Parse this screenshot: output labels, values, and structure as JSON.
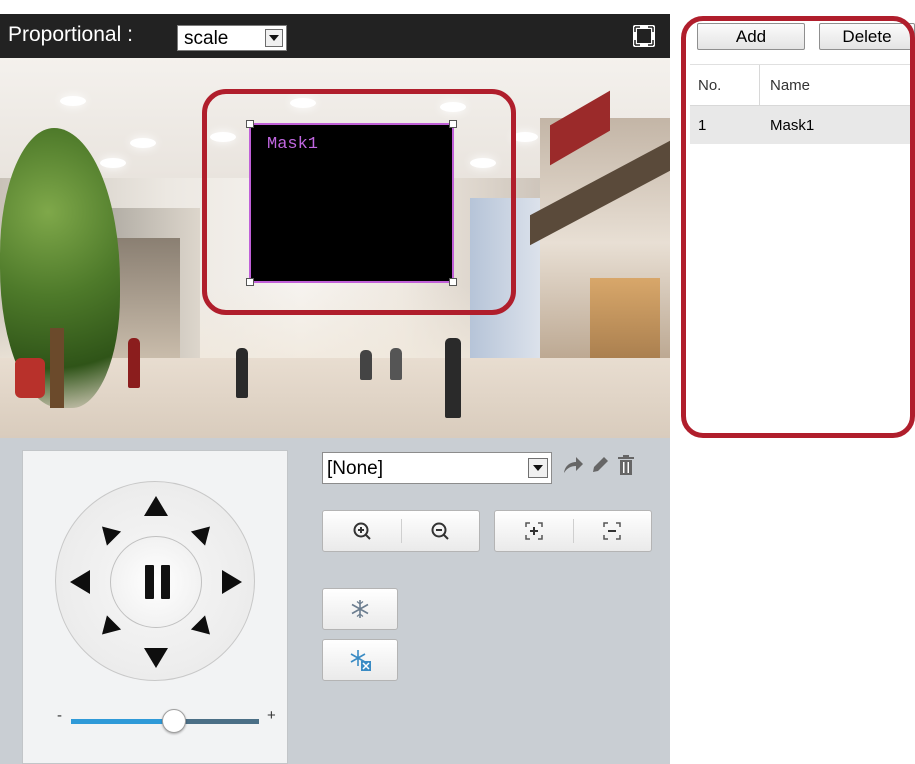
{
  "toolbar": {
    "proportional_label": "Proportional :",
    "scale_value": "scale"
  },
  "mask": {
    "label": "Mask1"
  },
  "ptz": {
    "preset_value": "[None]",
    "slider_minus": "-",
    "slider_plus": "+",
    "speed_level": 0.55
  },
  "mask_panel": {
    "add_label": "Add",
    "delete_label": "Delete",
    "columns": [
      "No.",
      "Name"
    ],
    "rows": [
      {
        "no": "1",
        "name": "Mask1"
      }
    ]
  },
  "colors": {
    "highlight": "#b01e2c",
    "mask_border": "#c060d8",
    "slider_active": "#2f9ad8",
    "ptz_bg": "#c9ced3"
  }
}
